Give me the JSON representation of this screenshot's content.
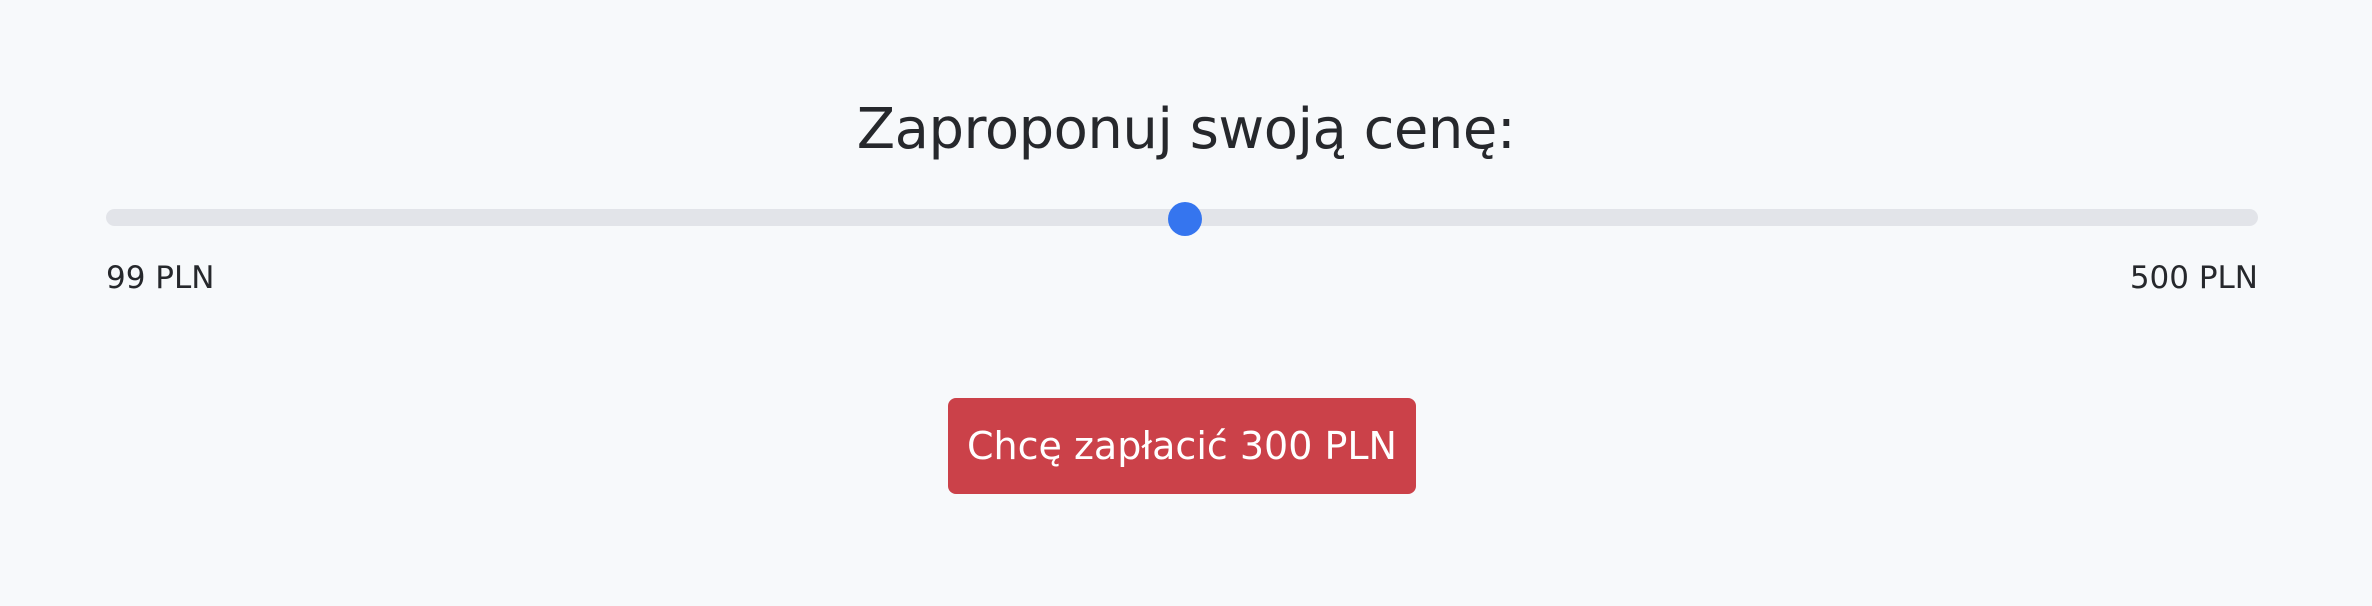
{
  "offer": {
    "title": "Zaproponuj swoją cenę:",
    "slider": {
      "min_label": "99 PLN",
      "max_label": "500 PLN",
      "min": 99,
      "max": 500,
      "value": 300
    },
    "submit_label": "Chcę zapłacić 300 PLN"
  },
  "colors": {
    "accent": "#3575ef",
    "button": "#cb4149",
    "track": "#e2e4e9",
    "background": "#f7f9fb"
  }
}
